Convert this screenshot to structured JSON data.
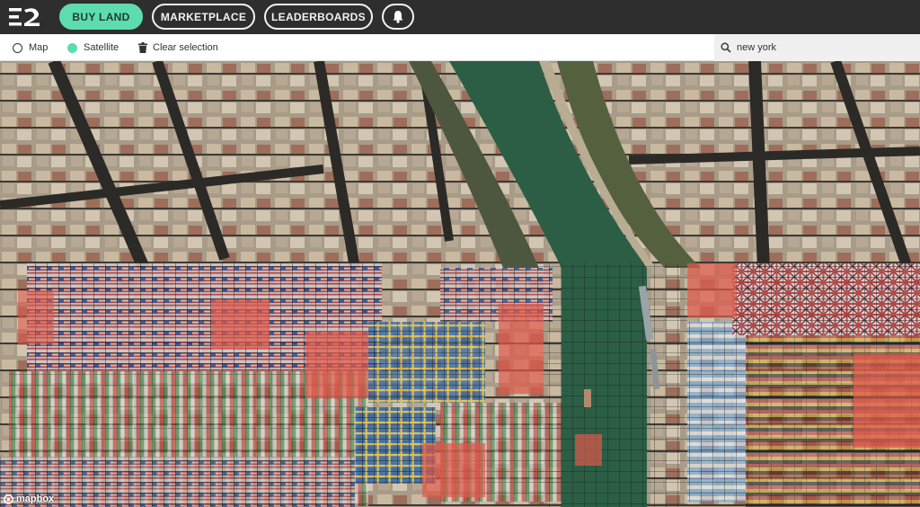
{
  "nav": {
    "buy_land": "BUY LAND",
    "marketplace": "MARKETPLACE",
    "leaderboards": "LEADERBOARDS"
  },
  "toolbar": {
    "map_label": "Map",
    "satellite_label": "Satellite",
    "clear_label": "Clear selection",
    "selected_view": "Satellite"
  },
  "search": {
    "value": "new york"
  },
  "map": {
    "credit": "mapbox"
  },
  "colors": {
    "accent": "#5ddcb0",
    "topbar": "#2e2e2e",
    "river": "#2b5e45"
  }
}
